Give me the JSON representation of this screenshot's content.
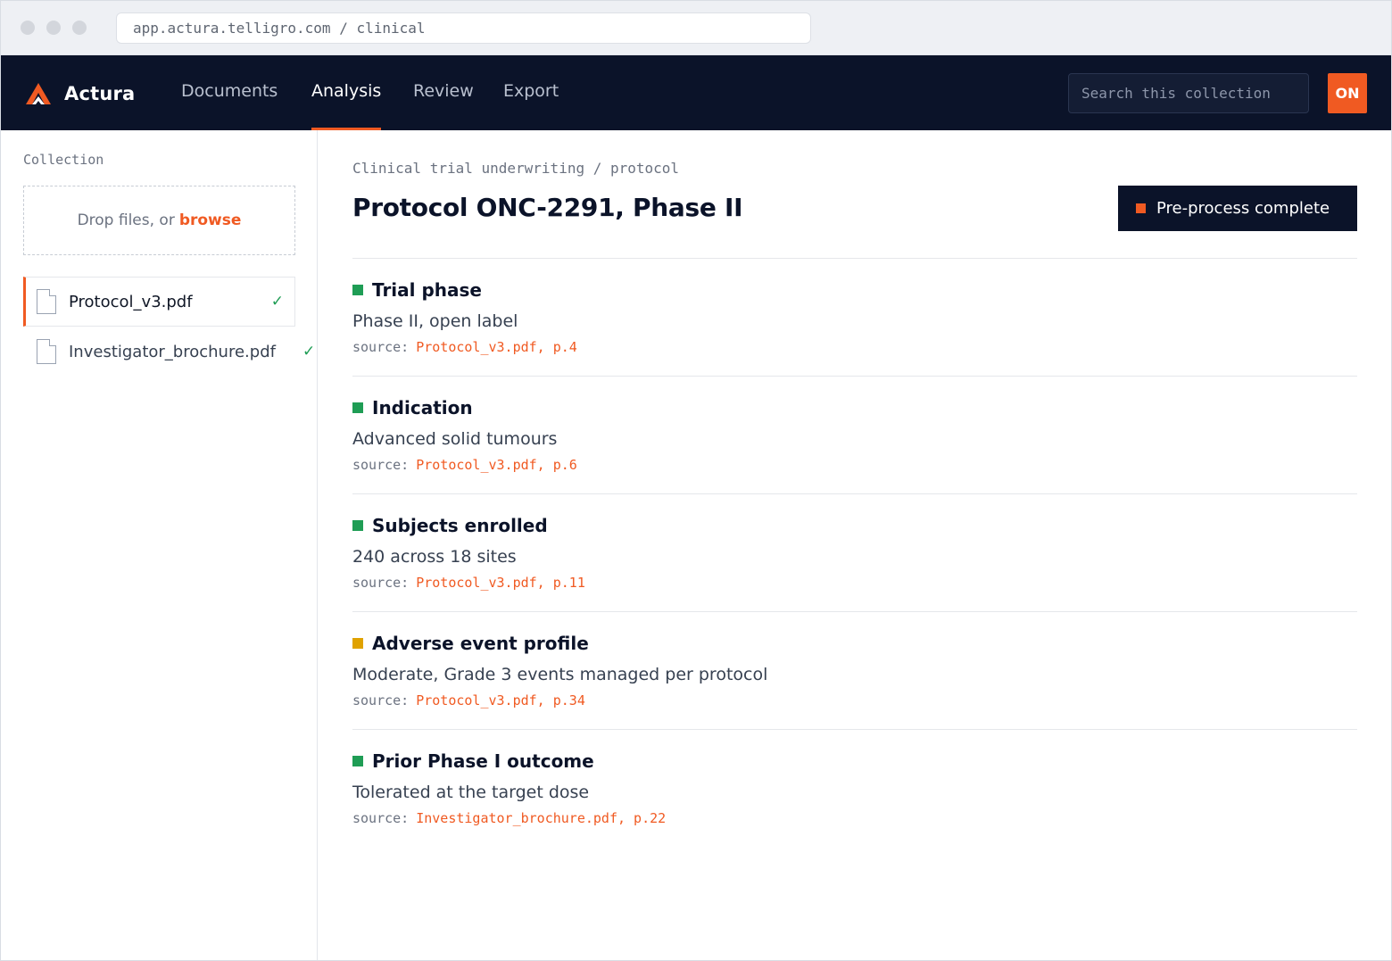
{
  "browser": {
    "url": "app.actura.telligro.com / clinical"
  },
  "header": {
    "brand": "Actura",
    "tabs": [
      {
        "label": "Documents",
        "active": false
      },
      {
        "label": "Analysis",
        "active": true
      },
      {
        "label": "Review",
        "active": false
      },
      {
        "label": "Export",
        "active": false
      }
    ],
    "search_placeholder": "Search this collection",
    "toggle_label": "ON"
  },
  "sidebar": {
    "heading": "Collection",
    "dropzone_text": "Drop files, or",
    "dropzone_link": "browse",
    "files": [
      {
        "name": "Protocol_v3.pdf",
        "status": "✓",
        "selected": true
      },
      {
        "name": "Investigator_brochure.pdf",
        "status": "✓",
        "selected": false
      }
    ]
  },
  "main": {
    "breadcrumb": "Clinical trial underwriting / protocol",
    "title": "Protocol ONC-2291, Phase II",
    "status_button": "Pre-process complete",
    "fields": [
      {
        "label": "Trial phase",
        "value": "Phase II, open label",
        "source_label": "source:",
        "source": "Protocol_v3.pdf, p.4",
        "status": "ok"
      },
      {
        "label": "Indication",
        "value": "Advanced solid tumours",
        "source_label": "source:",
        "source": "Protocol_v3.pdf, p.6",
        "status": "ok"
      },
      {
        "label": "Subjects enrolled",
        "value": "240 across 18 sites",
        "source_label": "source:",
        "source": "Protocol_v3.pdf, p.11",
        "status": "ok"
      },
      {
        "label": "Adverse event profile",
        "value": "Moderate, Grade 3 events managed per protocol",
        "source_label": "source:",
        "source": "Protocol_v3.pdf, p.34",
        "status": "warn"
      },
      {
        "label": "Prior Phase I outcome",
        "value": "Tolerated at the target dose",
        "source_label": "source:",
        "source": "Investigator_brochure.pdf, p.22",
        "status": "ok"
      }
    ]
  },
  "colors": {
    "accent": "#f05a22",
    "nav_bg": "#0b1329",
    "ok": "#1f9d55",
    "warn": "#e0a200"
  }
}
